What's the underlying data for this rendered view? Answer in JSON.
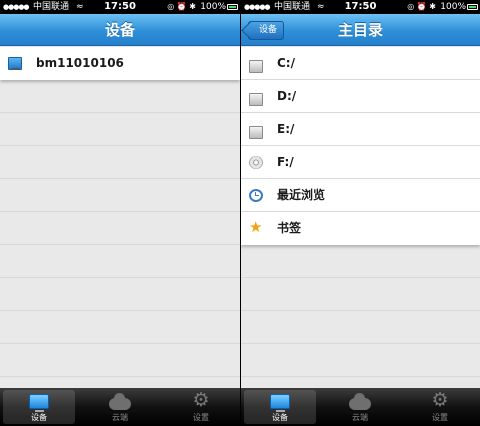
{
  "status_bar": {
    "signal": "●●●●●",
    "carrier": "中国联通",
    "wifi": "≈",
    "time": "17:50",
    "indicators": "◎ ⏰ ✱",
    "battery": "100%"
  },
  "left_screen": {
    "nav_title": "设备",
    "devices": [
      {
        "label": "bm11010106",
        "icon": "monitor-icon"
      }
    ]
  },
  "right_screen": {
    "nav_title": "主目录",
    "back_label": "设备",
    "items": [
      {
        "label": "C:/",
        "icon": "drive-icon"
      },
      {
        "label": "D:/",
        "icon": "drive-icon"
      },
      {
        "label": "E:/",
        "icon": "drive-icon"
      },
      {
        "label": "F:/",
        "icon": "cd-drive-icon"
      },
      {
        "label": "最近浏览",
        "icon": "clock-icon"
      },
      {
        "label": "书签",
        "icon": "star-icon"
      }
    ]
  },
  "tab_bar": {
    "tabs": [
      {
        "label": "设备",
        "icon": "monitor-icon",
        "selected": true
      },
      {
        "label": "云端",
        "icon": "cloud-icon",
        "selected": false
      },
      {
        "label": "设置",
        "icon": "gear-icon",
        "selected": false
      }
    ]
  },
  "colors": {
    "nav_blue": "#2e8fd8",
    "star_orange": "#f4a015",
    "selected_tab_text": "#ffffff"
  }
}
